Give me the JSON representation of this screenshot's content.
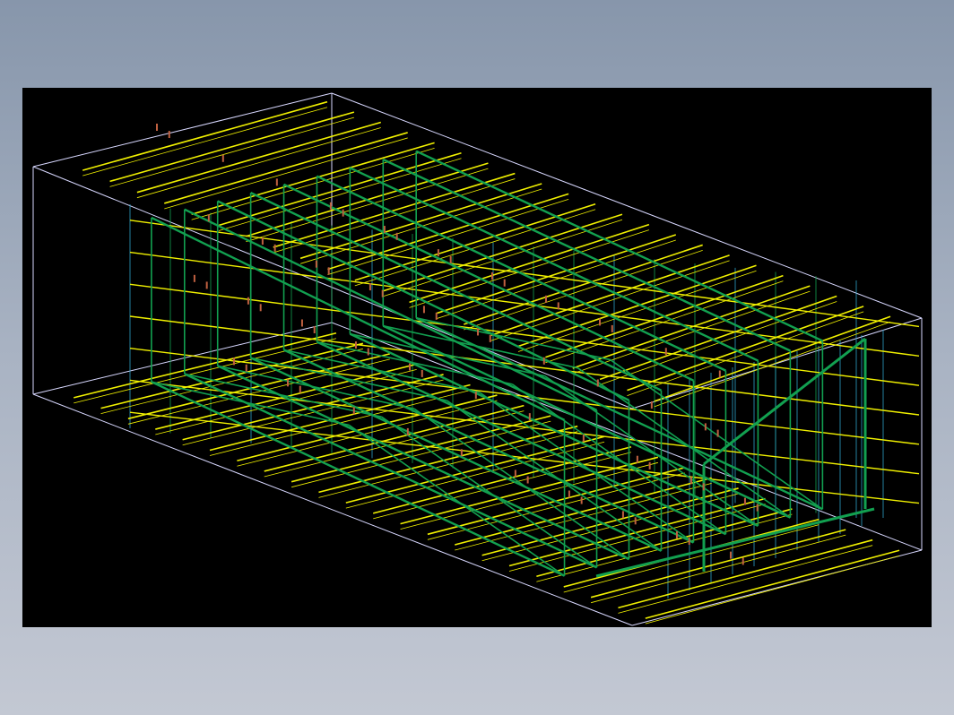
{
  "viewport": {
    "background": "#000000",
    "view": "3d-wireframe-isometric"
  },
  "model": {
    "type": "box-girder-frame-structure",
    "layer_colors": {
      "outline": "#d8d8ff",
      "longitudinal_stiffener": "#f0f000",
      "transverse_frame": "#12a050",
      "web_panel": "#2ea3c9",
      "bracket": "#c06040"
    },
    "bottom_stiffener_count": 22,
    "top_stiffener_count": 22,
    "side_stiffener_count": 7,
    "transverse_frame_count": 9
  }
}
